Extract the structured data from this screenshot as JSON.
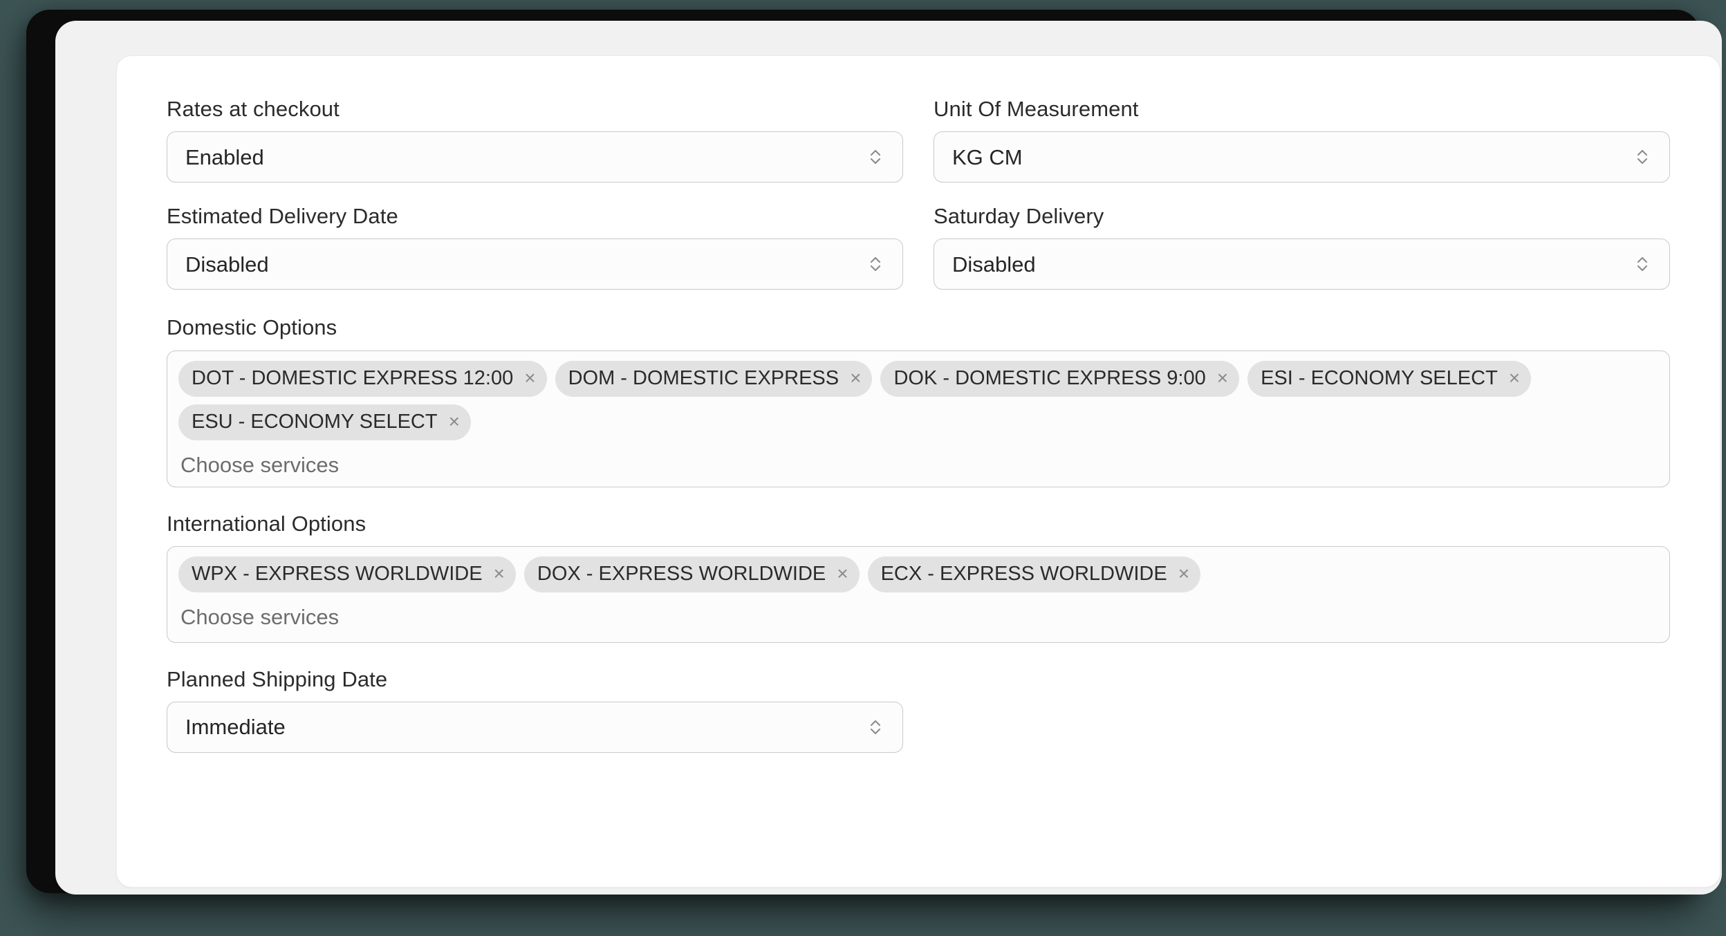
{
  "card": {
    "fields": {
      "rates_at_checkout": {
        "label": "Rates at checkout",
        "value": "Enabled"
      },
      "unit_of_measurement": {
        "label": "Unit Of Measurement",
        "value": "KG CM"
      },
      "estimated_delivery_date": {
        "label": "Estimated Delivery Date",
        "value": "Disabled"
      },
      "saturday_delivery": {
        "label": "Saturday Delivery",
        "value": "Disabled"
      },
      "domestic_options": {
        "label": "Domestic Options",
        "placeholder": "Choose services",
        "tags": [
          {
            "label": "DOT - DOMESTIC EXPRESS 12:00",
            "remove": "×"
          },
          {
            "label": "DOM - DOMESTIC EXPRESS",
            "remove": "×"
          },
          {
            "label": "DOK - DOMESTIC EXPRESS 9:00",
            "remove": "×"
          },
          {
            "label": "ESI - ECONOMY SELECT",
            "remove": "×"
          },
          {
            "label": "ESU - ECONOMY SELECT",
            "remove": "×"
          }
        ]
      },
      "international_options": {
        "label": "International Options",
        "placeholder": "Choose services",
        "tags": [
          {
            "label": "WPX - EXPRESS WORLDWIDE",
            "remove": "×"
          },
          {
            "label": "DOX - EXPRESS WORLDWIDE",
            "remove": "×"
          },
          {
            "label": "ECX - EXPRESS WORLDWIDE",
            "remove": "×"
          }
        ]
      },
      "planned_shipping_date": {
        "label": "Planned Shipping Date",
        "value": "Immediate"
      }
    }
  },
  "colors": {
    "page_background": "#3d5455",
    "window_frame": "#0c0c0c",
    "surface": "#f1f1f1",
    "card": "#ffffff",
    "control_border": "#c9c9c9",
    "control_fill": "#fcfcfc",
    "tag_fill": "#e2e2e2",
    "label_text": "#2b2b2b",
    "placeholder_text": "#6d6d6d",
    "chevron": "#8a8a8a"
  }
}
